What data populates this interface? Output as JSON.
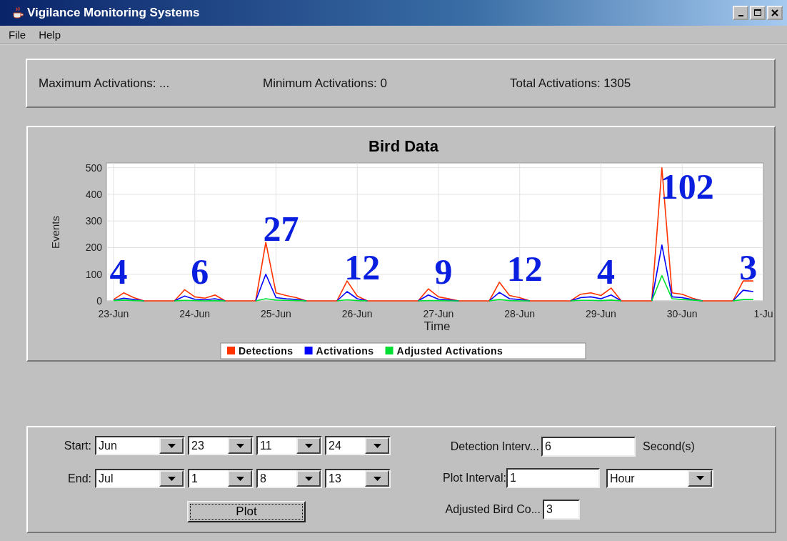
{
  "window": {
    "title": "Vigilance Monitoring Systems"
  },
  "menu": [
    "File",
    "Help"
  ],
  "summary": [
    "Maximum Activations: ...",
    "Minimum Activations: 0",
    "Total Activations: 1305"
  ],
  "chart": {
    "chart_data": {
      "type": "line",
      "title": "Bird Data",
      "xlabel": "Time",
      "ylabel": "Events",
      "categories": [
        "23-Jun",
        null,
        null,
        null,
        null,
        null,
        null,
        null,
        "24-Jun",
        null,
        null,
        null,
        null,
        null,
        null,
        null,
        "25-Jun",
        null,
        null,
        null,
        null,
        null,
        null,
        null,
        "26-Jun",
        null,
        null,
        null,
        null,
        null,
        null,
        null,
        "27-Jun",
        null,
        null,
        null,
        null,
        null,
        null,
        null,
        "28-Jun",
        null,
        null,
        null,
        null,
        null,
        null,
        null,
        "29-Jun",
        null,
        null,
        null,
        null,
        null,
        null,
        null,
        "30-Jun",
        null,
        null,
        null,
        null,
        null,
        null,
        null,
        "1-Ju"
      ],
      "series": [
        {
          "name": "Detections",
          "color": "#ff3300",
          "values": [
            5,
            30,
            12,
            0,
            0,
            0,
            0,
            42,
            15,
            10,
            22,
            0,
            0,
            0,
            0,
            220,
            30,
            20,
            12,
            0,
            0,
            0,
            0,
            75,
            18,
            0,
            0,
            0,
            0,
            0,
            0,
            45,
            15,
            8,
            0,
            0,
            0,
            0,
            70,
            20,
            12,
            0,
            0,
            0,
            0,
            0,
            25,
            30,
            20,
            48,
            0,
            0,
            0,
            0,
            500,
            30,
            25,
            10,
            0,
            0,
            0,
            0,
            75,
            75,
            null
          ]
        },
        {
          "name": "Activations",
          "color": "#0000ff",
          "values": [
            2,
            10,
            5,
            0,
            null,
            null,
            0,
            18,
            6,
            4,
            8,
            0,
            null,
            null,
            0,
            100,
            12,
            8,
            5,
            0,
            null,
            null,
            0,
            35,
            8,
            0,
            null,
            null,
            null,
            null,
            0,
            22,
            6,
            3,
            0,
            null,
            null,
            0,
            32,
            8,
            5,
            0,
            null,
            null,
            null,
            0,
            12,
            15,
            8,
            22,
            0,
            null,
            null,
            0,
            210,
            15,
            12,
            5,
            0,
            null,
            null,
            0,
            40,
            35,
            null
          ]
        },
        {
          "name": "Adjusted Activations",
          "color": "#00dd33",
          "values": [
            1,
            3,
            1,
            0,
            null,
            null,
            0,
            2,
            1,
            0,
            1,
            0,
            null,
            null,
            0,
            8,
            3,
            2,
            1,
            0,
            null,
            null,
            0,
            4,
            1,
            0,
            null,
            null,
            null,
            null,
            0,
            1,
            1,
            0,
            0,
            null,
            null,
            0,
            5,
            1,
            0,
            0,
            null,
            null,
            null,
            0,
            2,
            2,
            1,
            3,
            0,
            null,
            null,
            0,
            95,
            8,
            5,
            3,
            0,
            null,
            null,
            0,
            5,
            5,
            null
          ]
        }
      ],
      "ylim": [
        0,
        518
      ],
      "grid": true,
      "legend": true,
      "yticks": [
        0,
        100,
        200,
        300,
        400,
        500
      ],
      "annotations": [
        "4",
        "6",
        "27",
        "12",
        "9",
        "12",
        "4",
        "102",
        "3"
      ]
    }
  },
  "controls": {
    "start": {
      "label": "Start:",
      "fields": [
        "Jun",
        "23",
        "11",
        "24"
      ]
    },
    "end": {
      "label": "End:",
      "fields": [
        "Jul",
        "1",
        "8",
        "13"
      ]
    },
    "plot_button": {
      "label": "Plot",
      "focused": true
    },
    "detection_interval": {
      "label": "Detection Interv...",
      "value": "6",
      "unit": "Second(s)"
    },
    "plot_interval": {
      "label": "Plot Interval:",
      "value": "1",
      "unit": "Hour"
    },
    "adjusted_bird_count": {
      "label": "Adjusted Bird Co...",
      "value": "3"
    }
  }
}
